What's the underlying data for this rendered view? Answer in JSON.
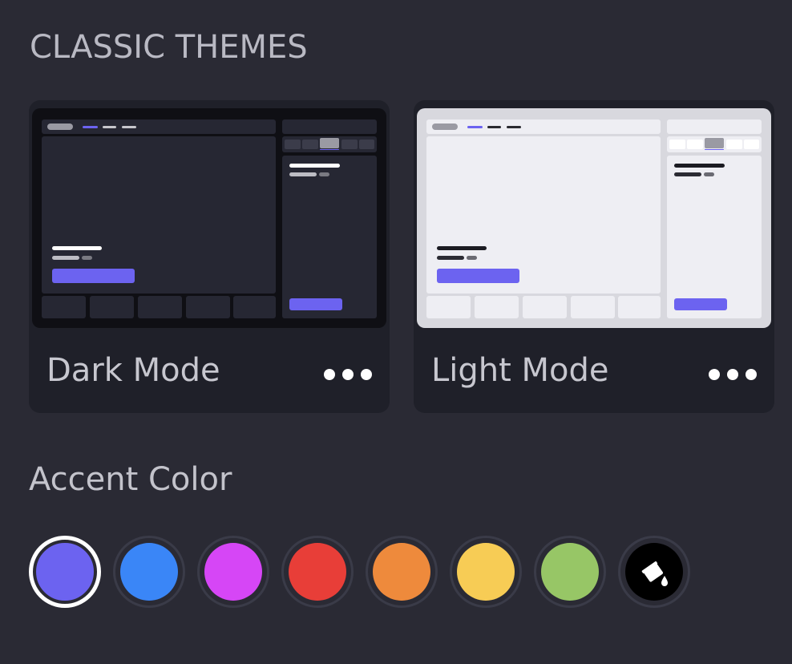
{
  "section": {
    "title": "CLASSIC THEMES"
  },
  "themes": [
    {
      "label": "Dark Mode",
      "more_icon": "more-horizontal-icon"
    },
    {
      "label": "Light Mode",
      "more_icon": "more-horizontal-icon"
    }
  ],
  "accent": {
    "title": "Accent Color",
    "selected": "#6c63f0",
    "swatches": [
      {
        "name": "purple",
        "color": "#6c63f0",
        "selected": true
      },
      {
        "name": "blue",
        "color": "#3a86f7"
      },
      {
        "name": "magenta",
        "color": "#d646f6"
      },
      {
        "name": "red",
        "color": "#e83e38"
      },
      {
        "name": "orange",
        "color": "#ee8a3c"
      },
      {
        "name": "yellow",
        "color": "#f7cc55"
      },
      {
        "name": "green",
        "color": "#97c666"
      },
      {
        "name": "custom",
        "color": "#000000",
        "icon": "paint-bucket-icon"
      }
    ]
  },
  "colors": {
    "background": "#2a2a34",
    "card": "#1f2029",
    "accent": "#6c63f0"
  }
}
